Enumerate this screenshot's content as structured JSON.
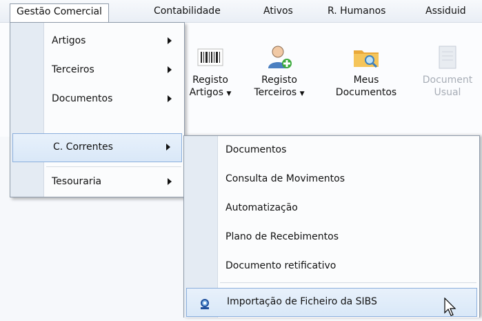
{
  "menubar": {
    "items": [
      {
        "label": "Gestão Comercial"
      },
      {
        "label": "Contabilidade"
      },
      {
        "label": "Ativos"
      },
      {
        "label": "R. Humanos"
      },
      {
        "label": "Assiduid"
      }
    ]
  },
  "ribbon": {
    "buttons": [
      {
        "line1": "Registo",
        "line2": "Artigos",
        "icon": "barcode-icon",
        "dropdown": true
      },
      {
        "line1": "Registo",
        "line2": "Terceiros",
        "icon": "add-user-icon",
        "dropdown": true
      },
      {
        "line1": "Meus",
        "line2": "Documentos",
        "icon": "folder-search-icon",
        "dropdown": false
      },
      {
        "line1": "Document",
        "line2": "Usual",
        "icon": "document-icon",
        "dropdown": false,
        "disabled": true
      }
    ]
  },
  "menu": {
    "items": [
      {
        "label": "Artigos",
        "has_submenu": true
      },
      {
        "label": "Terceiros",
        "has_submenu": true
      },
      {
        "label": "Documentos",
        "has_submenu": true
      },
      {
        "label": "C. Correntes",
        "has_submenu": true,
        "highlighted": true
      },
      {
        "label": "Tesouraria",
        "has_submenu": true
      }
    ]
  },
  "submenu": {
    "items": [
      {
        "label": "Documentos"
      },
      {
        "label": "Consulta de Movimentos"
      },
      {
        "label": "Automatização"
      },
      {
        "label": "Plano de Recebimentos"
      },
      {
        "label": "Documento retificativo"
      },
      {
        "label": "Importação de Ficheiro da SIBS",
        "icon": "sibs-import-icon",
        "highlighted": true
      }
    ]
  },
  "colors": {
    "highlight_bg": "#dbe8f8",
    "highlight_border": "#8aaedc",
    "menu_border": "#8e9aa9",
    "gutter": "#e4ebf3"
  }
}
